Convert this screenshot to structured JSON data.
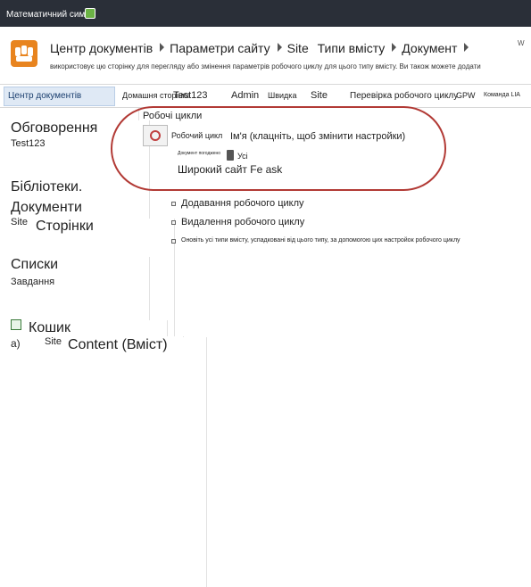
{
  "topbar": {
    "site_name": "Математичний сима"
  },
  "header": {
    "breadcrumb": [
      "Центр документів",
      "Параметри сайту",
      "Site",
      "Типи вмісту",
      "Документ"
    ],
    "breadcrumb_overflow": "W",
    "description": "використовує цю сторінку для перегляду або змінення параметрів робочого циклу для цього типу вмісту. Ви також можете додати"
  },
  "nav": {
    "current": "Центр документів",
    "items": [
      "Домашня сторінка",
      "Test123",
      "Admin",
      "Швидка",
      "Site",
      "Перевірка робочого циклу",
      "GPW",
      "Команда LIA"
    ]
  },
  "sidebar": {
    "discussions_heading": "Обговорення",
    "discussions_item": "Test123",
    "libraries_heading": "Бібліотеки.",
    "libraries_documents": "Документи",
    "libraries_site": "Site",
    "libraries_pages": "Сторінки",
    "lists_heading": "Списки",
    "lists_tasks": "Завдання",
    "recycle": "Кошик",
    "footnote_a": "a)",
    "site_content_site": "Site",
    "site_content_text": "Content (Вміст)"
  },
  "main": {
    "section_title": "Робочі цикли",
    "workflow_col": "Робочий цикл",
    "name_col": "Ім'я (клацніть, щоб змінити настройки)",
    "doc_note": "Документ погоджено",
    "all_text": "Усі",
    "workflow_name": "Широкий сайт Fe ask",
    "add_workflow": "Додавання робочого циклу",
    "remove_workflow": "Видалення робочого циклу",
    "update_all": "Оновіть усі типи вмісту, успадковані від цього типу, за допомогою цих настройок робочого циклу"
  },
  "colors": {
    "accent_ring": "#b23a35",
    "topbar": "#2a2f38",
    "logo": "#e8841f"
  }
}
